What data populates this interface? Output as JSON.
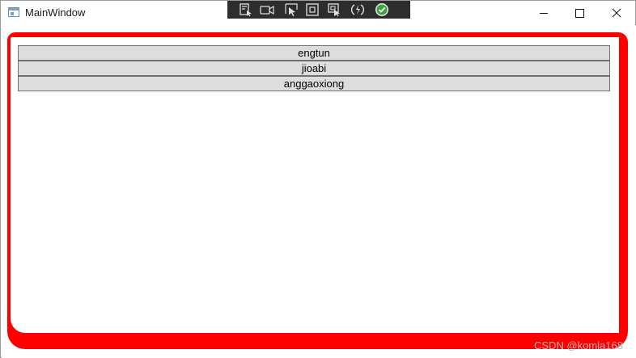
{
  "window": {
    "title": "MainWindow",
    "controls": [
      "minimize",
      "maximize",
      "close"
    ]
  },
  "debug_toolbar": {
    "icons": [
      "live-visual-tree-icon",
      "screen-record-icon",
      "select-element-icon",
      "display-layout-adorners-icon",
      "track-focus-icon",
      "hot-reload-icon",
      "binding-status-ok-icon"
    ]
  },
  "list": {
    "items": [
      {
        "label": "engtun"
      },
      {
        "label": "jioabi"
      },
      {
        "label": "anggaoxiong"
      }
    ]
  },
  "colors": {
    "frame_border": "#ff0000",
    "button_bg": "#dddddd",
    "button_border": "#707070",
    "toolbar_bg": "#2d2d30",
    "status_ok": "#2ea043"
  },
  "watermark": "CSDN @komla168"
}
